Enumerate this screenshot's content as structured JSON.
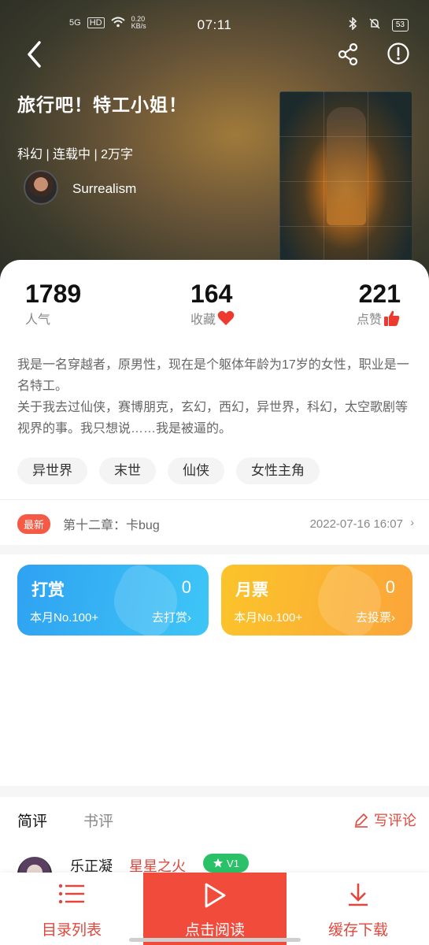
{
  "status": {
    "network": "5G",
    "hd": "HD",
    "speed": "0.20 KB/s",
    "time": "07:11",
    "battery": "53"
  },
  "nav": {
    "back_icon": "chevron-left-icon",
    "share_icon": "share-icon",
    "info_icon": "info-icon"
  },
  "book": {
    "title": "旅行吧！特工小姐！",
    "meta": "科幻 | 连载中 | 2万字",
    "author": "Surrealism"
  },
  "stats": {
    "popularity_value": "1789",
    "popularity_label": "人气",
    "favorites_value": "164",
    "favorites_label": "收藏",
    "likes_value": "221",
    "likes_label": "点赞"
  },
  "description": "我是一名穿越者，原男性，现在是个躯体年龄为17岁的女性，职业是一名特工。\n关于我去过仙侠，赛博朋克，玄幻，西幻，异世界，科幻，太空歌剧等视界的事。我只想说……我是被逼的。",
  "tags": [
    "异世界",
    "末世",
    "仙侠",
    "女性主角"
  ],
  "latest": {
    "badge": "最新",
    "chapter": "第十二章：卡bug",
    "time": "2022-07-16 16:07"
  },
  "rewards": {
    "tip_title": "打赏",
    "tip_count": "0",
    "tip_rank": "本月No.100+",
    "tip_action": "去打赏",
    "ticket_title": "月票",
    "ticket_count": "0",
    "ticket_rank": "本月No.100+",
    "ticket_action": "去投票"
  },
  "reviews": {
    "tab_brief": "简评",
    "tab_book": "书评",
    "write": "写评论",
    "first": {
      "name": "乐正凝",
      "level": "星星之火",
      "badge": "V1"
    }
  },
  "bottom": {
    "toc": "目录列表",
    "read": "点击阅读",
    "download": "缓存下载"
  },
  "colors": {
    "accent": "#f14b3c",
    "tip_blue": "#2fa2f2",
    "ticket_orange": "#fbb030",
    "badge_green": "#2bc168"
  }
}
